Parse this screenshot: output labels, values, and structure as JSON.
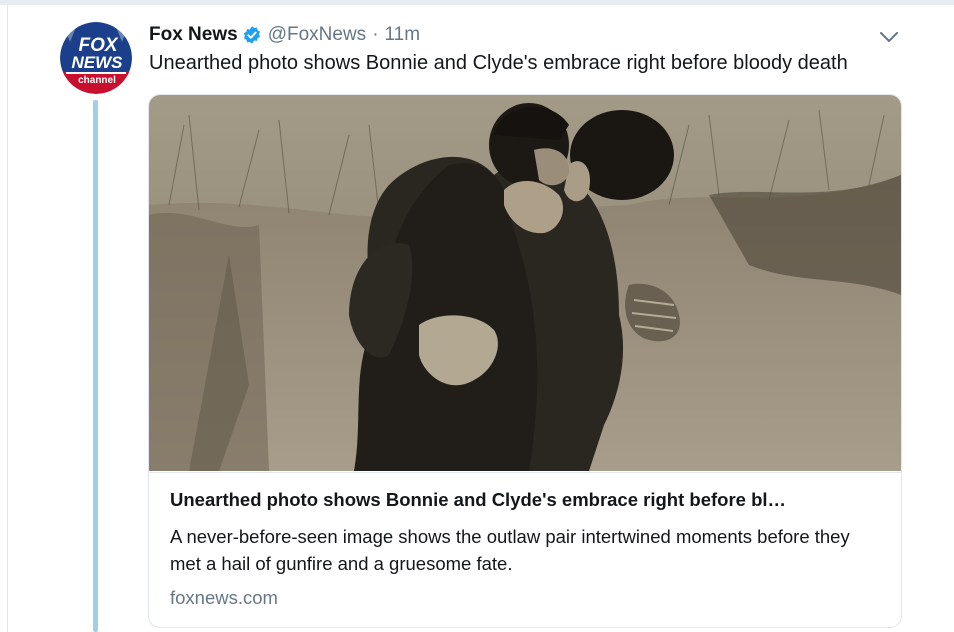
{
  "tweet": {
    "author": {
      "display_name": "Fox News",
      "handle": "@FoxNews",
      "verified": true,
      "avatar_logo_lines": [
        "FOX",
        "NEWS",
        "channel"
      ]
    },
    "separator": "·",
    "time": "11m",
    "text": "Unearthed photo shows Bonnie and Clyde's embrace right before bloody death",
    "caret_icon": "chevron-down-icon",
    "card": {
      "title": "Unearthed photo shows Bonnie and Clyde's embrace right before bl…",
      "description": "A never-before-seen image shows the outlaw pair intertwined moments before they met a hail of gunfire and a gruesome fate.",
      "domain": "foxnews.com"
    }
  },
  "colors": {
    "text": "#14171a",
    "muted": "#657786",
    "verified": "#1da1f2",
    "thread_line": "#9fd0e6",
    "border": "#e1e8ed",
    "fox_blue": "#1b3f8b",
    "fox_red": "#c8102e"
  }
}
